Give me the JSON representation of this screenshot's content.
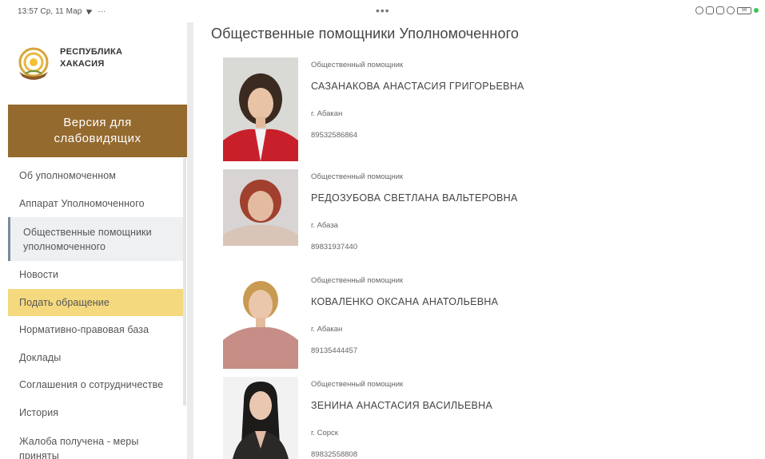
{
  "statusbar": {
    "time_date": "13:57 Ср, 11 Мар",
    "dots": "•••",
    "battery": "98"
  },
  "sidebar": {
    "logo_line1": "РЕСПУБЛИКА",
    "logo_line2": "ХАКАСИЯ",
    "version_line1": "Версия для",
    "version_line2": "слабовидящих",
    "items": [
      {
        "label": "Об уполномоченном"
      },
      {
        "label": "Аппарат Уполномоченного"
      },
      {
        "label_line1": "Общественные помощники",
        "label_line2": "уполномоченного"
      },
      {
        "label": "Новости"
      },
      {
        "label": "Подать обращение"
      },
      {
        "label": "Нормативно-правовая база"
      },
      {
        "label": "Доклады"
      },
      {
        "label": "Соглашения о сотрудничестве"
      },
      {
        "label": "История"
      },
      {
        "label_line1": "Жалоба получена - меры",
        "label_line2": "приняты"
      }
    ]
  },
  "main": {
    "title": "Общественные помощники Уполномоченного",
    "people": [
      {
        "role": "Общественный помощник",
        "name": "САЗАНАКОВА АНАСТАСИЯ ГРИГОРЬЕВНА",
        "city": "г. Абакан",
        "phone": "89532586864"
      },
      {
        "role": "Общественный помощник",
        "name": "РЕДОЗУБОВА СВЕТЛАНА ВАЛЬТЕРОВНА",
        "city": "г. Абаза",
        "phone": "89831937440"
      },
      {
        "role": "Общественный помощник",
        "name": "КОВАЛЕНКО ОКСАНА АНАТОЛЬЕВНА",
        "city": "г. Абакан",
        "phone": "89135444457"
      },
      {
        "role": "Общественный помощник",
        "name": "ЗЕНИНА АНАСТАСИЯ ВАСИЛЬЕВНА",
        "city": "г. Сорск",
        "phone": "89832558808"
      }
    ]
  },
  "colors": {
    "version_bg": "#946a2f",
    "highlight_bg": "#f4d97e",
    "active_bg": "#eef0f1"
  }
}
